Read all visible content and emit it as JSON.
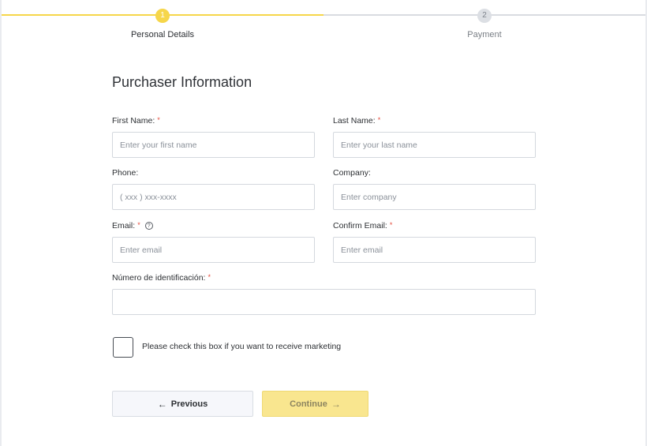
{
  "colors": {
    "accent": "#f6d64a",
    "accent_light": "#f9e68f",
    "secondary_button_bg": "#f6f7fb",
    "required": "#e5493a"
  },
  "stepper": {
    "steps": [
      {
        "number": "1",
        "label": "Personal Details",
        "state": "active"
      },
      {
        "number": "2",
        "label": "Payment",
        "state": "inactive"
      }
    ]
  },
  "form": {
    "title": "Purchaser Information",
    "required_mark": "*",
    "fields": {
      "first_name": {
        "label": "First Name:",
        "placeholder": "Enter your first name",
        "value": "",
        "required": true
      },
      "last_name": {
        "label": "Last Name:",
        "placeholder": "Enter your last name",
        "value": "",
        "required": true
      },
      "phone": {
        "label": "Phone:",
        "placeholder": "( xxx ) xxx-xxxx",
        "value": "",
        "required": false
      },
      "company": {
        "label": "Company:",
        "placeholder": "Enter company",
        "value": "",
        "required": false
      },
      "email": {
        "label": "Email:",
        "placeholder": "Enter email",
        "value": "",
        "required": true,
        "help_icon": "question-circle-icon",
        "help_glyph": "?"
      },
      "confirm_email": {
        "label": "Confirm Email:",
        "placeholder": "Enter email",
        "value": "",
        "required": true
      },
      "id_number": {
        "label": "Número de identificación:",
        "placeholder": "",
        "value": "",
        "required": true
      }
    },
    "marketing": {
      "label": "Please check this box if you want to receive marketing",
      "checked": false
    }
  },
  "buttons": {
    "previous": {
      "label": "Previous",
      "icon": "arrow-left-icon",
      "glyph": "←"
    },
    "continue": {
      "label": "Continue",
      "icon": "arrow-right-icon",
      "glyph": "→"
    }
  }
}
